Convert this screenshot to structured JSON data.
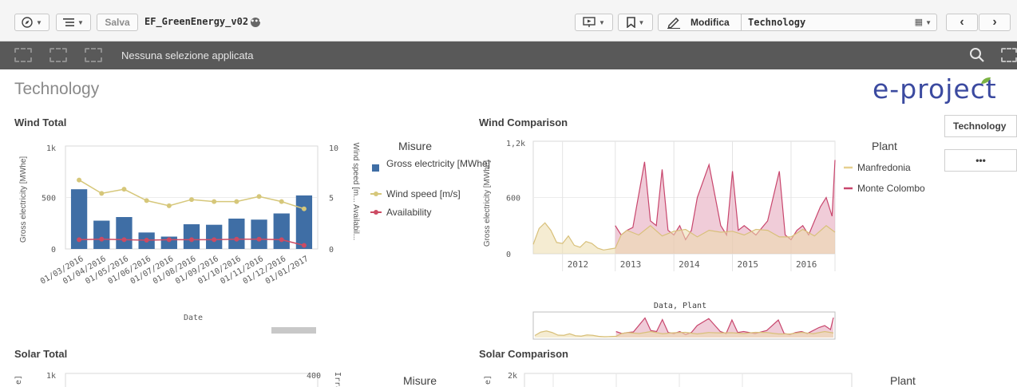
{
  "toolbar": {
    "save_label": "Salva",
    "app_name": "EF_GreenEnergy_v02",
    "edit_label": "Modifica",
    "current_sheet": "Technology"
  },
  "selection_bar": {
    "status_text": "Nessuna selezione applicata"
  },
  "sheet": {
    "title": "Technology",
    "logo_text": "e-project"
  },
  "right_panel": {
    "sheet_button": "Technology",
    "more_button": "•••"
  },
  "wind_total": {
    "title": "Wind Total",
    "ylabel_left": "Gross electricity [MWhe]",
    "ylabel_right": "Wind speed [m... Availabil...",
    "xlabel": "Date",
    "legend_title": "Misure",
    "legend": [
      "Gross electricity [MWhe]",
      "Wind speed [m/s]",
      "Availability"
    ],
    "left_ticks": [
      "1k",
      "500",
      "0"
    ],
    "right_ticks": [
      "10",
      "5",
      "0"
    ]
  },
  "wind_comparison": {
    "title": "Wind Comparison",
    "ylabel": "Gross electricity [MWhe]",
    "legend_title": "Plant",
    "legend": [
      "Manfredonia",
      "Monte Colombo"
    ],
    "y_ticks": [
      "1,2k",
      "600",
      "0"
    ],
    "x_ticks": [
      "2012",
      "2013",
      "2014",
      "2015",
      "2016"
    ],
    "minimap_label": "Data, Plant"
  },
  "solar_total": {
    "title": "Solar Total",
    "left_tick_top": "1k",
    "right_tick_top": "400",
    "legend_title": "Misure"
  },
  "solar_comparison": {
    "title": "Solar Comparison",
    "y_tick_top": "2k",
    "legend_title": "Plant"
  },
  "colors": {
    "bar": "#3f6ea5",
    "wind_speed": "#d6c77a",
    "availability": "#cc4b63",
    "manfredonia": "#e6d08f",
    "monte_colombo": "#c8466d"
  },
  "chart_data": [
    {
      "type": "bar",
      "title": "Wind Total",
      "xlabel": "Date",
      "ylabel": "Gross electricity [MWhe]",
      "ylim": [
        0,
        1000
      ],
      "y2lim": [
        0,
        10
      ],
      "categories": [
        "01/03/2016",
        "01/04/2016",
        "01/05/2016",
        "01/06/2016",
        "01/07/2016",
        "01/08/2016",
        "01/09/2016",
        "01/10/2016",
        "01/11/2016",
        "01/12/2016",
        "01/01/2017"
      ],
      "series": [
        {
          "name": "Gross electricity [MWhe]",
          "axis": "left",
          "type": "bar",
          "values": [
            580,
            275,
            310,
            160,
            120,
            240,
            235,
            295,
            285,
            345,
            520
          ]
        },
        {
          "name": "Wind speed [m/s]",
          "axis": "right",
          "type": "line",
          "values": [
            6.7,
            5.4,
            5.8,
            4.7,
            4.2,
            4.8,
            4.6,
            4.6,
            5.1,
            4.6,
            3.9
          ]
        },
        {
          "name": "Availability",
          "axis": "right",
          "type": "line",
          "values": [
            0.9,
            0.95,
            0.9,
            0.85,
            0.9,
            0.9,
            0.9,
            0.95,
            0.95,
            0.9,
            0.35
          ]
        }
      ],
      "legend_position": "right"
    },
    {
      "type": "area",
      "title": "Wind Comparison",
      "ylabel": "Gross electricity [MWhe]",
      "ylim": [
        0,
        1200
      ],
      "x_ticks": [
        "2012",
        "2013",
        "2014",
        "2015",
        "2016"
      ],
      "series": [
        {
          "name": "Manfredonia",
          "x": [
            2011.6,
            2011.7,
            2011.8,
            2011.9,
            2012.0,
            2012.1,
            2012.2,
            2012.3,
            2012.4,
            2012.5,
            2012.6,
            2012.7,
            2012.8,
            2012.9,
            2013.0,
            2013.1,
            2013.2,
            2013.4,
            2013.6,
            2013.8,
            2014.0,
            2014.2,
            2014.4,
            2014.6,
            2014.8,
            2015.0,
            2015.2,
            2015.4,
            2015.6,
            2015.8,
            2016.0,
            2016.2,
            2016.4,
            2016.6,
            2016.75
          ],
          "values": [
            100,
            270,
            330,
            250,
            120,
            110,
            190,
            90,
            70,
            130,
            110,
            60,
            40,
            50,
            60,
            200,
            250,
            200,
            300,
            190,
            240,
            260,
            180,
            250,
            230,
            240,
            200,
            260,
            250,
            180,
            180,
            260,
            190,
            300,
            230
          ]
        },
        {
          "name": "Monte Colombo",
          "x": [
            2013.0,
            2013.1,
            2013.2,
            2013.3,
            2013.5,
            2013.6,
            2013.7,
            2013.8,
            2013.9,
            2014.0,
            2014.1,
            2014.2,
            2014.3,
            2014.4,
            2014.6,
            2014.8,
            2014.9,
            2015.0,
            2015.1,
            2015.2,
            2015.4,
            2015.6,
            2015.8,
            2015.9,
            2016.0,
            2016.1,
            2016.2,
            2016.3,
            2016.5,
            2016.6,
            2016.7,
            2016.75
          ],
          "values": [
            300,
            200,
            250,
            280,
            980,
            350,
            300,
            900,
            250,
            200,
            300,
            150,
            250,
            600,
            950,
            300,
            200,
            880,
            250,
            300,
            200,
            350,
            880,
            200,
            150,
            250,
            300,
            200,
            500,
            600,
            400,
            1000
          ]
        }
      ],
      "legend_position": "right"
    }
  ]
}
